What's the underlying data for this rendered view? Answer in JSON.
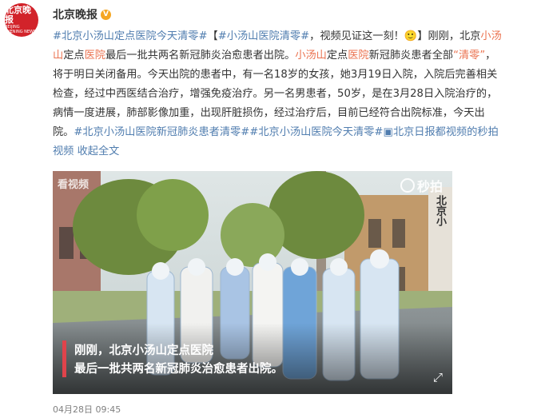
{
  "account": {
    "name": "北京晚报",
    "avatar_text": "北京晚报",
    "avatar_sub": "BEIJING EVENING NEWS"
  },
  "post": {
    "tag1": "#北京小汤山定点医院今天清零#",
    "tag2": "#小汤山医院清零#",
    "text1": "，视频见证这一刻！",
    "emoji": "🙂",
    "text2": "】刚刚，北京",
    "link_place1": "小汤山",
    "text3": "定点",
    "link_hospital1": "医院",
    "text4": "最后一批共两名新冠肺炎治愈患者出院。",
    "link_place2": "小汤山",
    "text5": "定点",
    "link_hospital2": "医院",
    "text6": "新冠肺炎患者全部",
    "link_clear": "“清零”",
    "text7": "，将于明日关闭备用。今天出院的患者中，有一名18岁的女孩，她3月19日入院，入院后完善相关检查，经过中西医结合治疗，增强免疫治疗。另一名男患者，50岁，是在3月28日入院治疗的，病情一度进展，肺部影像加重，出现肝脏损伤，经过治疗后，目前已经符合出院标准，今天出院。",
    "tag3": "#北京小汤山医院新冠肺炎患者清零#",
    "tag4": "#北京小汤山医院今天清零#",
    "video_link": "北京日报都视频的秒拍视频",
    "collapse": "收起全文"
  },
  "video": {
    "caption_line1": "刚刚，北京小汤山定点医院",
    "caption_line2": "最后一批共两名新冠肺炎治愈患者出院。",
    "watermark_left": "看视频",
    "watermark_right": "秒拍",
    "building_sign": "北京小"
  },
  "meta": {
    "timestamp": "04月28日 09:45"
  }
}
